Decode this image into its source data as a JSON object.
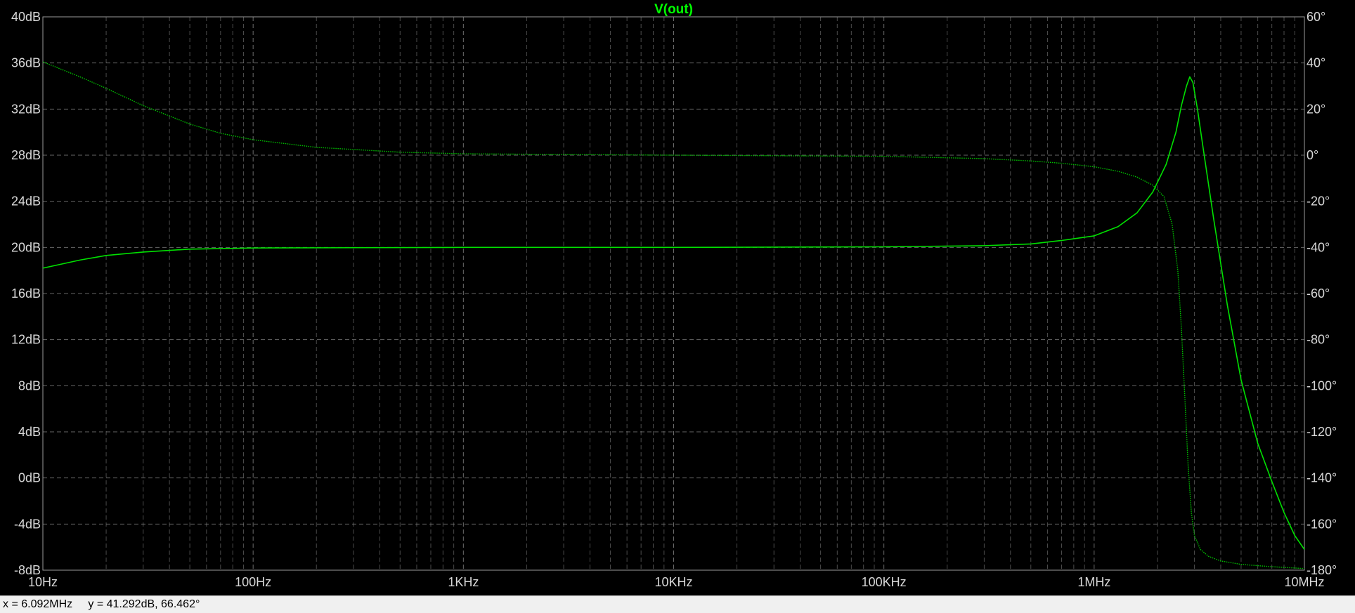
{
  "window": {
    "trace_title": "V(out)",
    "trace_color": "#00ff00"
  },
  "status_bar": {
    "x_readout": "x = 6.092MHz",
    "y_readout": "y = 41.292dB, 66.462°"
  },
  "chart_data": {
    "type": "line",
    "title": "V(out)",
    "xscale": "log",
    "xlim": [
      10,
      10000000
    ],
    "ylim_left": [
      -8,
      40
    ],
    "ylim_right": [
      -180,
      60
    ],
    "grid": true,
    "background": "#000000",
    "grid_color": "#888888",
    "x_tick_values": [
      10,
      100,
      1000,
      10000,
      100000,
      1000000,
      10000000
    ],
    "x_tick_labels": [
      "10Hz",
      "100Hz",
      "1KHz",
      "10KHz",
      "100KHz",
      "1MHz",
      "10MHz"
    ],
    "y_left_ticks": [
      40,
      36,
      32,
      28,
      24,
      20,
      16,
      12,
      8,
      4,
      0,
      -4,
      -8
    ],
    "y_left_labels": [
      "40dB",
      "36dB",
      "32dB",
      "28dB",
      "24dB",
      "20dB",
      "16dB",
      "12dB",
      "8dB",
      "4dB",
      "0dB",
      "-4dB",
      "-8dB"
    ],
    "y_right_ticks": [
      60,
      40,
      20,
      0,
      -20,
      -40,
      -60,
      -80,
      -100,
      -120,
      -140,
      -160,
      -180
    ],
    "y_right_labels": [
      "60°",
      "40°",
      "20°",
      "0°",
      "-20°",
      "-40°",
      "-60°",
      "-80°",
      "-100°",
      "-120°",
      "-140°",
      "-160°",
      "-180°"
    ],
    "series": [
      {
        "role": "magnitude",
        "axis": "left",
        "style": "solid",
        "color": "#00e000",
        "x": [
          10,
          15,
          20,
          30,
          50,
          100,
          1000,
          10000,
          100000,
          300000,
          500000,
          700000,
          1000000,
          1300000,
          1600000,
          1900000,
          2200000,
          2450000,
          2600000,
          2750000,
          2850000,
          2950000,
          3100000,
          3300000,
          3700000,
          4300000,
          5000000,
          6000000,
          7000000,
          8000000,
          9000000,
          10000000
        ],
        "y": [
          18.2,
          18.9,
          19.3,
          19.6,
          19.85,
          19.95,
          20.0,
          20.0,
          20.05,
          20.15,
          20.3,
          20.6,
          21.0,
          21.8,
          23.0,
          24.8,
          27.2,
          30.0,
          32.3,
          34.0,
          34.8,
          34.3,
          32.0,
          28.6,
          22.5,
          15.0,
          8.5,
          3.0,
          -0.3,
          -3.0,
          -5.0,
          -6.2
        ]
      },
      {
        "role": "phase",
        "axis": "right",
        "style": "dotted",
        "color": "#00c000",
        "x": [
          10,
          15,
          20,
          30,
          50,
          70,
          100,
          200,
          500,
          1000,
          10000,
          100000,
          300000,
          500000,
          700000,
          1000000,
          1300000,
          1600000,
          1900000,
          2150000,
          2350000,
          2500000,
          2600000,
          2700000,
          2800000,
          2900000,
          3000000,
          3200000,
          3500000,
          4000000,
          5000000,
          7000000,
          10000000
        ],
        "y": [
          40.5,
          34.0,
          29.0,
          21.5,
          13.5,
          9.5,
          6.7,
          3.4,
          1.3,
          0.6,
          0.0,
          -0.5,
          -1.5,
          -2.5,
          -3.5,
          -5.0,
          -7.0,
          -9.5,
          -13.0,
          -18.0,
          -30.0,
          -50.0,
          -75.0,
          -105.0,
          -135.0,
          -155.0,
          -165.0,
          -171.0,
          -174.0,
          -176.0,
          -177.5,
          -178.5,
          -179.3
        ]
      }
    ]
  }
}
